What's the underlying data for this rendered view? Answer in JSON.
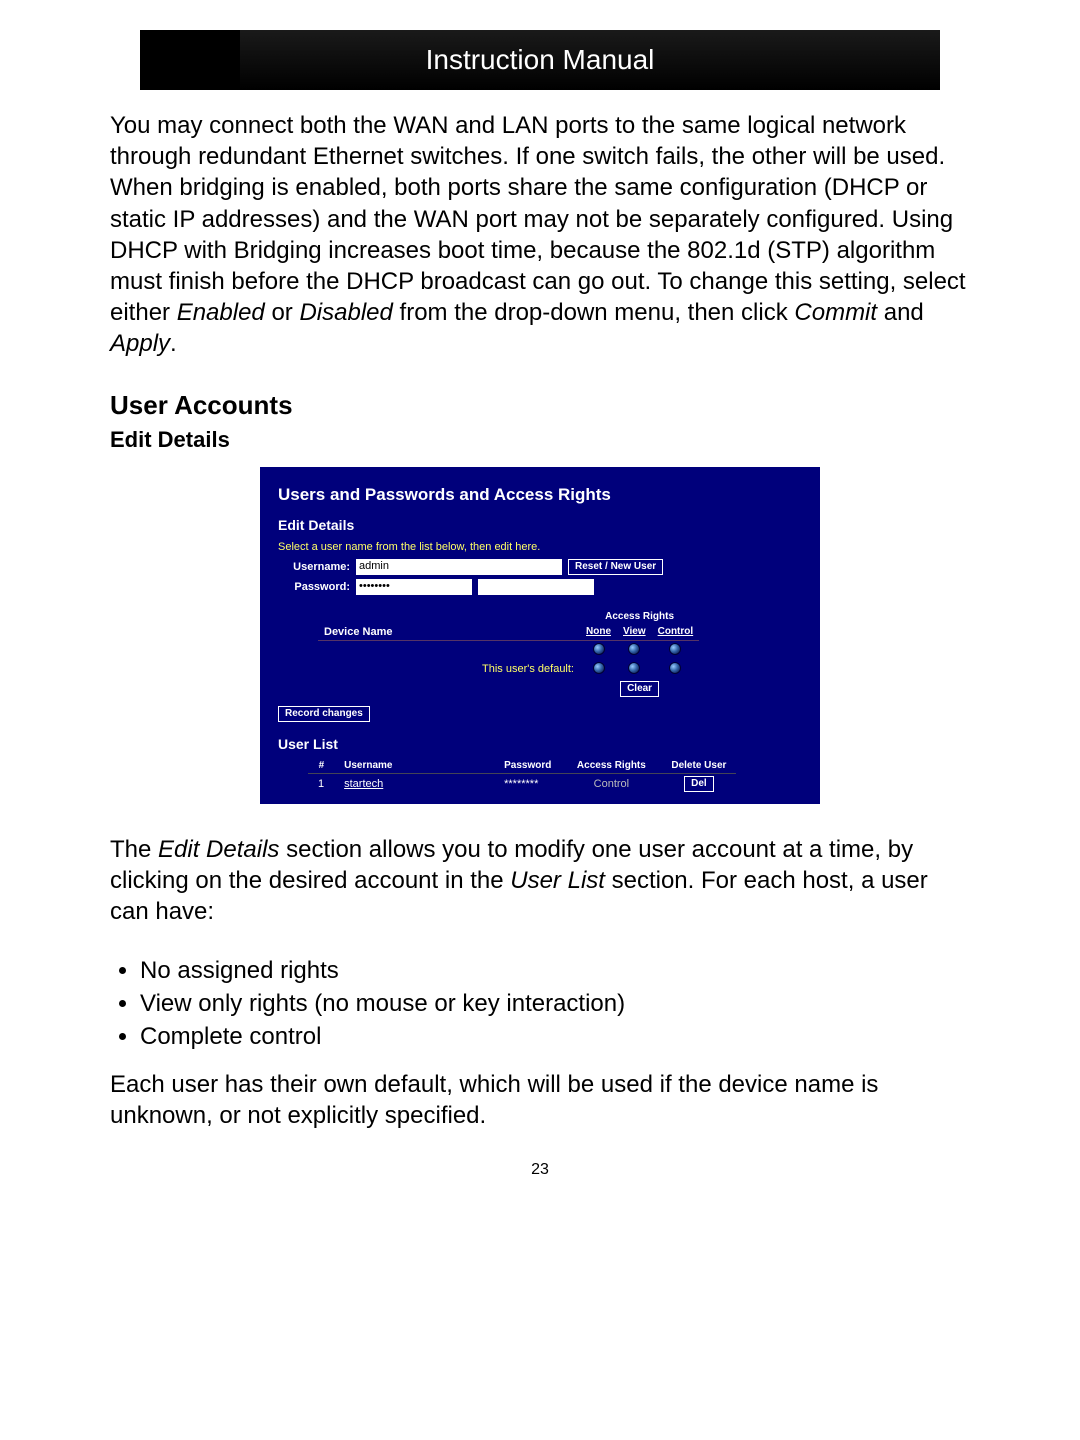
{
  "header": {
    "title": "Instruction Manual"
  },
  "intro": {
    "p1a": "You may connect both the WAN and LAN ports to the same logical network through redundant Ethernet switches. If one switch fails, the other will be used. When bridging is enabled, both ports share the same configuration (DHCP or static IP addresses) and the WAN port may not be separately configured. Using DHCP with Bridging increases boot time, because the 802.1d (STP) algorithm must finish before the DHCP broadcast can go out. To change this setting, select either ",
    "enabled": "Enabled",
    "or": " or ",
    "disabled": "Disabled",
    "p1b": " from the drop-down menu, then click ",
    "commit": "Commit",
    "and": " and ",
    "apply": "Apply",
    "dot": "."
  },
  "section": {
    "title": "User Accounts",
    "subtitle": "Edit Details"
  },
  "screenshot": {
    "title": "Users and Passwords and Access Rights",
    "edit_title": "Edit Details",
    "hint": "Select a user name from the list below, then edit here.",
    "username_label": "Username:",
    "username_value": "admin",
    "reset_btn": "Reset / New User",
    "password_label": "Password:",
    "password_value": "••••••••",
    "password_confirm": "",
    "device_name_header": "Device Name",
    "access_rights_header": "Access Rights",
    "col_none": "None",
    "col_view": "View",
    "col_control": "Control",
    "default_label": "This user's default:",
    "clear_btn": "Clear",
    "record_btn": "Record changes",
    "userlist_title": "User List",
    "ul_cols": {
      "num": "#",
      "username": "Username",
      "password": "Password",
      "rights": "Access Rights",
      "delete": "Delete User"
    },
    "ul_row": {
      "num": "1",
      "username": "startech",
      "password": "********",
      "rights": "Control",
      "del_btn": "Del"
    }
  },
  "desc": {
    "p1a": "The ",
    "edit_details": "Edit Details",
    "p1b": " section allows you to modify one user account at a time, by clicking on the desired account in the ",
    "user_list": "User List",
    "p1c": " section.  For each host, a user can have:"
  },
  "bullets": {
    "b1": "No assigned rights",
    "b2": "View only rights (no mouse or key interaction)",
    "b3": "Complete control"
  },
  "desc2": "Each user has their own default, which will be used if the device name is unknown, or not explicitly specified.",
  "page_number": "23"
}
